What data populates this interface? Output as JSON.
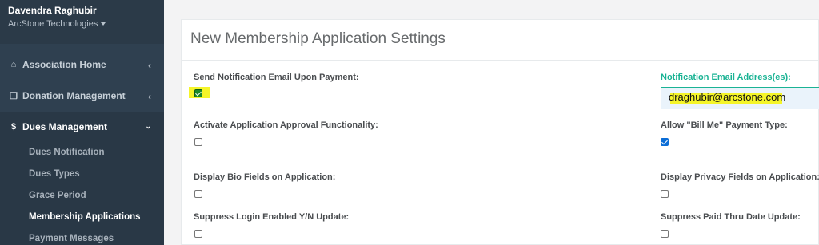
{
  "user": {
    "name": "Davendra Raghubir",
    "org": "ArcStone Technologies"
  },
  "nav": {
    "association_home": "Association Home",
    "donation_management": "Donation Management",
    "dues_management": "Dues Management",
    "sub_items": [
      "Dues Notification",
      "Dues Types",
      "Grace Period",
      "Membership Applications",
      "Payment Messages"
    ]
  },
  "icons": {
    "home": "home-icon",
    "gift": "gift-icon",
    "dollar": "dollar-icon"
  },
  "panel": {
    "title": "New Membership Application Settings",
    "fields": {
      "send_notification": "Send Notification Email Upon Payment:",
      "notification_email_label": "Notification Email Address(es):",
      "notification_email_value": "draghubir@arcstone.com",
      "activate_approval": "Activate Application Approval Functionality:",
      "allow_bill_me": "Allow \"Bill Me\" Payment Type:",
      "display_bio": "Display Bio Fields on Application:",
      "display_privacy": "Display Privacy Fields on Application:",
      "suppress_login": "Suppress Login Enabled Y/N Update:",
      "suppress_paid_thru": "Suppress Paid Thru Date Update:"
    }
  },
  "colors": {
    "sidebar": "#2f4050",
    "accent_teal": "#1ab394",
    "checkbox_blue": "#0b6dd6",
    "highlight": "#f5f52a"
  },
  "checkbox_states": {
    "send_notification": true,
    "activate_approval": false,
    "allow_bill_me": true,
    "display_bio": false,
    "display_privacy": false,
    "suppress_login": false,
    "suppress_paid_thru": false
  }
}
